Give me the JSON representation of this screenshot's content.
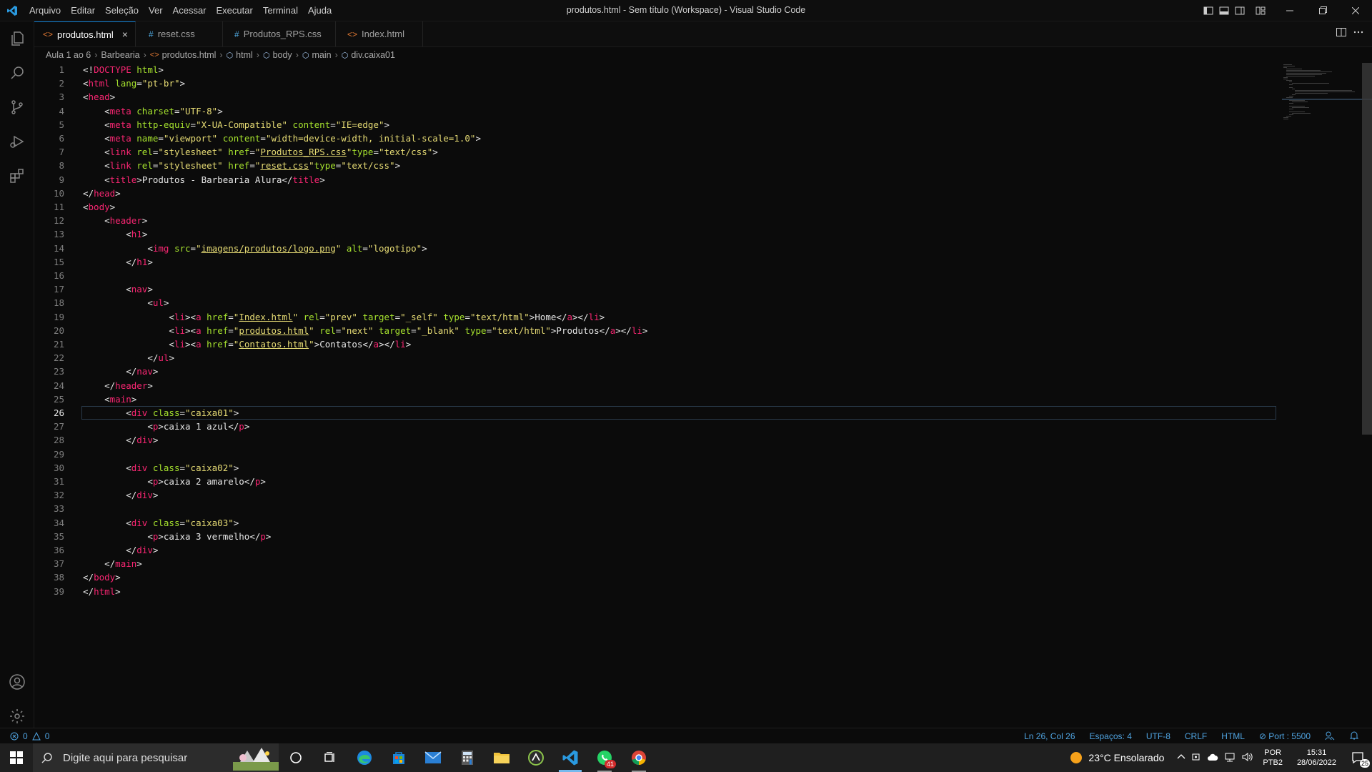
{
  "window": {
    "title": "produtos.html - Sem título (Workspace) - Visual Studio Code",
    "menu": [
      "Arquivo",
      "Editar",
      "Seleção",
      "Ver",
      "Acessar",
      "Executar",
      "Terminal",
      "Ajuda"
    ]
  },
  "tabs": [
    {
      "icon": "<>",
      "label": "produtos.html",
      "close": "×"
    },
    {
      "icon": "#",
      "label": "reset.css"
    },
    {
      "icon": "#",
      "label": "Produtos_RPS.css"
    },
    {
      "icon": "<>",
      "label": "Index.html"
    }
  ],
  "breadcrumb": {
    "items": [
      "Aula 1 ao 6",
      "Barbearia",
      "produtos.html",
      "html",
      "body",
      "main",
      "div.caixa01"
    ]
  },
  "editor": {
    "current_line": 26,
    "lines": [
      {
        "n": "1"
      },
      {
        "n": "2"
      },
      {
        "n": "3"
      },
      {
        "n": "4"
      },
      {
        "n": "5"
      },
      {
        "n": "6"
      },
      {
        "n": "7"
      },
      {
        "n": "8"
      },
      {
        "n": "9"
      },
      {
        "n": "10"
      },
      {
        "n": "11"
      },
      {
        "n": "12"
      },
      {
        "n": "13"
      },
      {
        "n": "14"
      },
      {
        "n": "15"
      },
      {
        "n": "16"
      },
      {
        "n": "17"
      },
      {
        "n": "18"
      },
      {
        "n": "19"
      },
      {
        "n": "20"
      },
      {
        "n": "21"
      },
      {
        "n": "22"
      },
      {
        "n": "23"
      },
      {
        "n": "24"
      },
      {
        "n": "25"
      },
      {
        "n": "26"
      },
      {
        "n": "27"
      },
      {
        "n": "28"
      },
      {
        "n": "29"
      },
      {
        "n": "30"
      },
      {
        "n": "31"
      },
      {
        "n": "32"
      },
      {
        "n": "33"
      },
      {
        "n": "34"
      },
      {
        "n": "35"
      },
      {
        "n": "36"
      },
      {
        "n": "37"
      },
      {
        "n": "38"
      },
      {
        "n": "39"
      }
    ],
    "code": [
      "<!DOCTYPE html>",
      "<html lang=\"pt-br\">",
      "<head>",
      "    <meta charset=\"UTF-8\">",
      "    <meta http-equiv=\"X-UA-Compatible\" content=\"IE=edge\">",
      "    <meta name=\"viewport\" content=\"width=device-width, initial-scale=1.0\">",
      "    <link rel=\"stylesheet\" href=\"Produtos_RPS.css\"type=\"text/css\">",
      "    <link rel=\"stylesheet\" href=\"reset.css\"type=\"text/css\">",
      "    <title>Produtos - Barbearia Alura</title>",
      "</head>",
      "<body>",
      "    <header>",
      "        <h1>",
      "            <img src=\"imagens/produtos/logo.png\" alt=\"logotipo\">",
      "        </h1>",
      "",
      "        <nav>",
      "            <ul>",
      "                <li><a href=\"Index.html\" rel=\"prev\" target=\"_self\" type=\"text/html\">Home</a></li>",
      "                <li><a href=\"produtos.html\" rel=\"next\" target=\"_blank\" type=\"text/html\">Produtos</a></li>",
      "                <li><a href=\"Contatos.html\">Contatos</a></li>",
      "            </ul>",
      "        </nav>",
      "    </header>",
      "    <main>",
      "        <div class=\"caixa01\">",
      "            <p>caixa 1 azul</p>",
      "        </div>",
      "",
      "        <div class=\"caixa02\">",
      "            <p>caixa 2 amarelo</p>",
      "        </div>",
      "",
      "        <div class=\"caixa03\">",
      "            <p>caixa 3 vermelho</p>",
      "        </div>",
      "    </main>",
      "</body>",
      "</html>"
    ]
  },
  "statusbar": {
    "errors": "0",
    "warnings": "0",
    "position": "Ln 26, Col 26",
    "spaces": "Espaços: 4",
    "encoding": "UTF-8",
    "eol": "CRLF",
    "language": "HTML",
    "port": "Port : 5500"
  },
  "taskbar": {
    "search_placeholder": "Digite aqui para pesquisar",
    "whatsapp_badge": "41",
    "weather": "23°C  Ensolarado",
    "lang_top": "POR",
    "lang_bottom": "PTB2",
    "time": "15:31",
    "date": "28/06/2022",
    "notifications": "25"
  },
  "colors": {
    "tag": "#f92672",
    "attr": "#a6e22e",
    "value": "#e6db74",
    "accent": "#0e7fd4"
  }
}
